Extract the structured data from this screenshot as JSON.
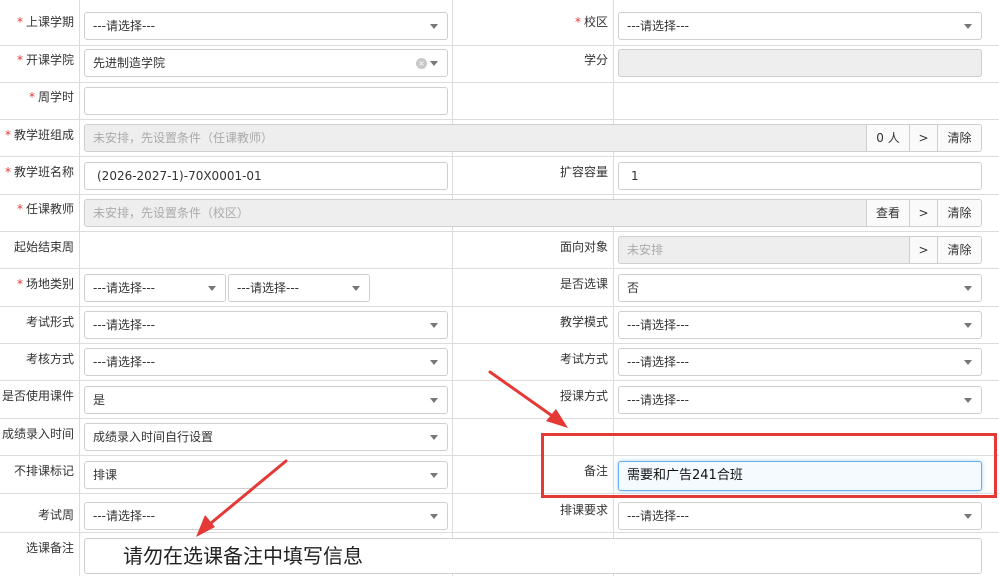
{
  "placeholder_select": "---请选择---",
  "rows": {
    "semester": {
      "label": "上课学期",
      "required": true,
      "value": "---请选择---"
    },
    "campus": {
      "label": "校区",
      "required": true,
      "value": "---请选择---"
    },
    "college": {
      "label": "开课学院",
      "required": true,
      "value": "先进制造学院",
      "clear_glyph": "×"
    },
    "credits": {
      "label": "学分",
      "value": ""
    },
    "weekly_hours": {
      "label": "周学时",
      "required": true,
      "value": ""
    },
    "class_composition": {
      "label": "教学班组成",
      "required": true,
      "placeholder": "未安排，先设置条件（任课教师）",
      "count": "0 人",
      "next_btn": ">",
      "clear_btn": "清除"
    },
    "class_name": {
      "label": "教学班名称",
      "required": true,
      "value": "(2026-2027-1)-70X0001-01"
    },
    "expand_capacity": {
      "label": "扩容容量",
      "value": "1"
    },
    "teacher": {
      "label": "任课教师",
      "required": true,
      "placeholder": "未安排，先设置条件（校区）",
      "view_btn": "查看",
      "next_btn": ">",
      "clear_btn": "清除"
    },
    "start_end_week": {
      "label": "起始结束周"
    },
    "target_audience": {
      "label": "面向对象",
      "placeholder": "未安排",
      "next_btn": ">",
      "clear_btn": "清除"
    },
    "venue_type": {
      "label": "场地类别",
      "required": true,
      "value1": "---请选择---",
      "value2": "---请选择---"
    },
    "elective": {
      "label": "是否选课",
      "value": "否"
    },
    "exam_form": {
      "label": "考试形式",
      "value": "---请选择---"
    },
    "teaching_mode": {
      "label": "教学模式",
      "value": "---请选择---"
    },
    "assessment_method": {
      "label": "考核方式",
      "value": "---请选择---"
    },
    "exam_method": {
      "label": "考试方式",
      "value": "---请选择---"
    },
    "use_courseware": {
      "label": "是否使用课件",
      "value": "是"
    },
    "teaching_method": {
      "label": "授课方式",
      "value": "---请选择---"
    },
    "grade_entry_time": {
      "label": "成绩录入时间",
      "value": "成绩录入时间自行设置"
    },
    "no_schedule_flag": {
      "label": "不排课标记",
      "value": "排课"
    },
    "remarks": {
      "label": "备注",
      "value": "需要和广告241合班"
    },
    "exam_week": {
      "label": "考试周",
      "value": "---请选择---"
    },
    "schedule_requirement": {
      "label": "排课要求",
      "value": "---请选择---"
    },
    "elective_remarks": {
      "label": "选课备注",
      "overlay_text": "请勿在选课备注中填写信息"
    }
  },
  "annotation": {
    "color": "#e53935"
  }
}
